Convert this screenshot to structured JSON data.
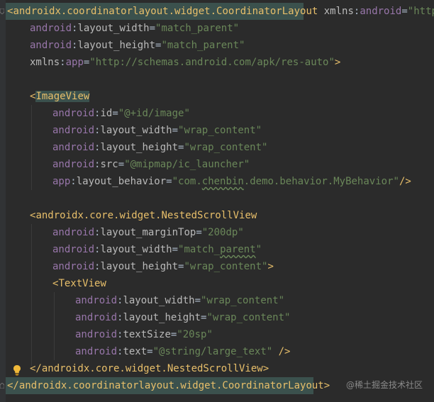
{
  "code": {
    "line1": {
      "open": "<",
      "tag": "androidx.coordinatorlayout.widget.CoordinatorLayout",
      "space": " ",
      "ns": "xmlns",
      "colon": ":",
      "attr": "android",
      "eq": "=",
      "value": "\"http://s"
    },
    "line2": {
      "ns": "android",
      "colon": ":",
      "attr": "layout_width",
      "eq": "=",
      "value": "\"match_parent\""
    },
    "line3": {
      "ns": "android",
      "colon": ":",
      "attr": "layout_height",
      "eq": "=",
      "value": "\"match_parent\""
    },
    "line4": {
      "ns": "xmlns",
      "colon": ":",
      "attr": "app",
      "eq": "=",
      "value": "\"http://schemas.android.com/apk/res-auto\"",
      "close": ">"
    },
    "line6": {
      "open": "<",
      "tag": "ImageView"
    },
    "line7": {
      "ns": "android",
      "colon": ":",
      "attr": "id",
      "eq": "=",
      "value": "\"@+id/image\""
    },
    "line8": {
      "ns": "android",
      "colon": ":",
      "attr": "layout_width",
      "eq": "=",
      "value": "\"wrap_content\""
    },
    "line9": {
      "ns": "android",
      "colon": ":",
      "attr": "layout_height",
      "eq": "=",
      "value": "\"wrap_content\""
    },
    "line10": {
      "ns": "android",
      "colon": ":",
      "attr": "src",
      "eq": "=",
      "value": "\"@mipmap/ic_launcher\""
    },
    "line11": {
      "ns": "app",
      "colon": ":",
      "attr": "layout_behavior",
      "eq": "=",
      "value_a": "\"com.",
      "value_b": "chenbin",
      "value_c": ".demo.behavior.MyBehavior\"",
      "close": "/>"
    },
    "line13": {
      "open": "<",
      "tag": "androidx.core.widget.NestedScrollView"
    },
    "line14": {
      "ns": "android",
      "colon": ":",
      "attr": "layout_marginTop",
      "eq": "=",
      "value": "\"200dp\""
    },
    "line15": {
      "ns": "android",
      "colon": ":",
      "attr": "layout_width",
      "eq": "=",
      "value_a": "\"match_",
      "value_b": "parent",
      "value_c": "\""
    },
    "line16": {
      "ns": "android",
      "colon": ":",
      "attr": "layout_height",
      "eq": "=",
      "value": "\"wrap_content\"",
      "close": ">"
    },
    "line17": {
      "open": "<",
      "tag": "TextView"
    },
    "line18": {
      "ns": "android",
      "colon": ":",
      "attr": "layout_width",
      "eq": "=",
      "value": "\"wrap_content\""
    },
    "line19": {
      "ns": "android",
      "colon": ":",
      "attr": "layout_height",
      "eq": "=",
      "value": "\"wrap_content\""
    },
    "line20": {
      "ns": "android",
      "colon": ":",
      "attr": "textSize",
      "eq": "=",
      "value": "\"20sp\""
    },
    "line21": {
      "ns": "android",
      "colon": ":",
      "attr": "text",
      "eq": "=",
      "value": "\"@string/large_text\"",
      "close": " />"
    },
    "line22": {
      "open": "</",
      "tag": "androidx.core.widget.NestedScrollView",
      "close": ">"
    },
    "line23": {
      "open": "</",
      "tag": "androidx.coordinatorlayout.widget.CoordinatorLayout",
      "close": ">"
    }
  },
  "watermark": "@稀土掘金技术社区",
  "icons": {
    "intention": "lightbulb-icon"
  },
  "colors": {
    "background": "#2b2b2b",
    "tag": "#e8bf6a",
    "namespace": "#9876aa",
    "attribute": "#bababa",
    "string": "#6a8759",
    "highlight": "#3b514d"
  }
}
